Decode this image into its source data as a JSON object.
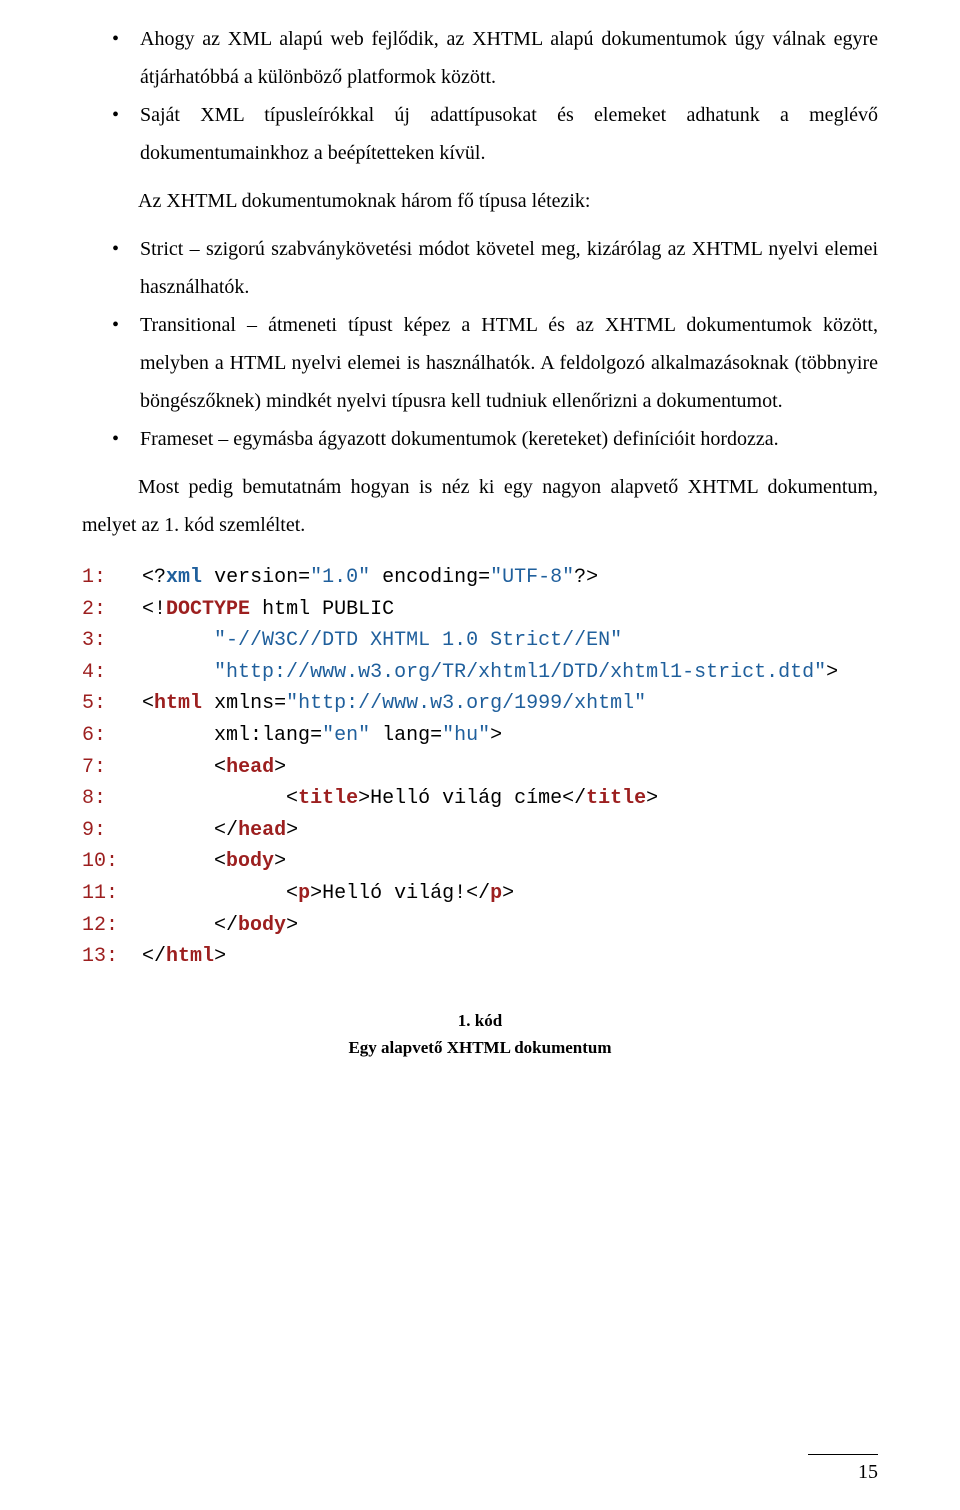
{
  "bullets_top": [
    "Ahogy az XML alapú web fejlődik, az XHTML alapú dokumentumok úgy válnak egyre átjárhatóbbá a különböző platformok között.",
    "Saját XML típusleírókkal új adattípusokat és elemeket adhatunk a meglévő dokumentumainkhoz a beépítetteken kívül."
  ],
  "intro_para": "Az XHTML dokumentumoknak három fő típusa létezik:",
  "bullets_types": [
    "Strict – szigorú szabványkövetési módot követel meg, kizárólag az XHTML nyelvi elemei használhatók.",
    "Transitional – átmeneti típust képez a HTML és az XHTML dokumentumok között, melyben a HTML nyelvi elemei is használhatók. A feldolgozó alkalmazásoknak (többnyire böngészőknek) mindkét nyelvi típusra kell tudniuk ellenőrizni a dokumentumot.",
    "Frameset – egymásba ágyazott dokumentumok (kereteket) definícióit hordozza."
  ],
  "example_para": "Most pedig bemutatnám hogyan is néz ki egy nagyon alapvető XHTML dokumentum, melyet az 1. kód szemléltet.",
  "code": {
    "l1": {
      "ln": "1:",
      "pre": "<?",
      "pi": "xml",
      "rest": " version=",
      "v1": "\"1.0\"",
      "mid": " encoding=",
      "v2": "\"UTF-8\"",
      "end": "?>"
    },
    "l2": {
      "ln": "2:",
      "pre": "<!",
      "kw": "DOCTYPE",
      "rest": " html PUBLIC"
    },
    "l3": {
      "ln": "3:",
      "str": "\"-//W3C//DTD XHTML 1.0 Strict//EN\""
    },
    "l4": {
      "ln": "4:",
      "str": "\"http://www.w3.org/TR/xhtml1/DTD/xhtml1-strict.dtd\"",
      "end": ">"
    },
    "l5": {
      "ln": "5:",
      "pre": "<",
      "tag": "html",
      "attr": " xmlns=",
      "v1": "\"http://www.w3.org/1999/xhtml\""
    },
    "l6": {
      "ln": "6:",
      "a1": "xml:lang=",
      "v1": "\"en\"",
      "a2": " lang=",
      "v2": "\"hu\"",
      "end": ">"
    },
    "l7": {
      "ln": "7:",
      "pre": "<",
      "tag": "head",
      "end": ">"
    },
    "l8": {
      "ln": "8:",
      "pre": "<",
      "tag": "title",
      "mid": ">",
      "txt": "Helló világ címe",
      "pre2": "</",
      "tag2": "title",
      "end": ">"
    },
    "l9": {
      "ln": "9:",
      "pre": "</",
      "tag": "head",
      "end": ">"
    },
    "l10": {
      "ln": "10:",
      "pre": "<",
      "tag": "body",
      "end": ">"
    },
    "l11": {
      "ln": "11:",
      "pre": "<",
      "tag": "p",
      "mid": ">",
      "txt": "Helló világ!",
      "pre2": "</",
      "tag2": "p",
      "end": ">"
    },
    "l12": {
      "ln": "12:",
      "pre": "</",
      "tag": "body",
      "end": ">"
    },
    "l13": {
      "ln": "13:",
      "pre": "</",
      "tag": "html",
      "end": ">"
    }
  },
  "caption_num": "1. kód",
  "caption_text": "Egy alapvető XHTML dokumentum",
  "page_num": "15"
}
